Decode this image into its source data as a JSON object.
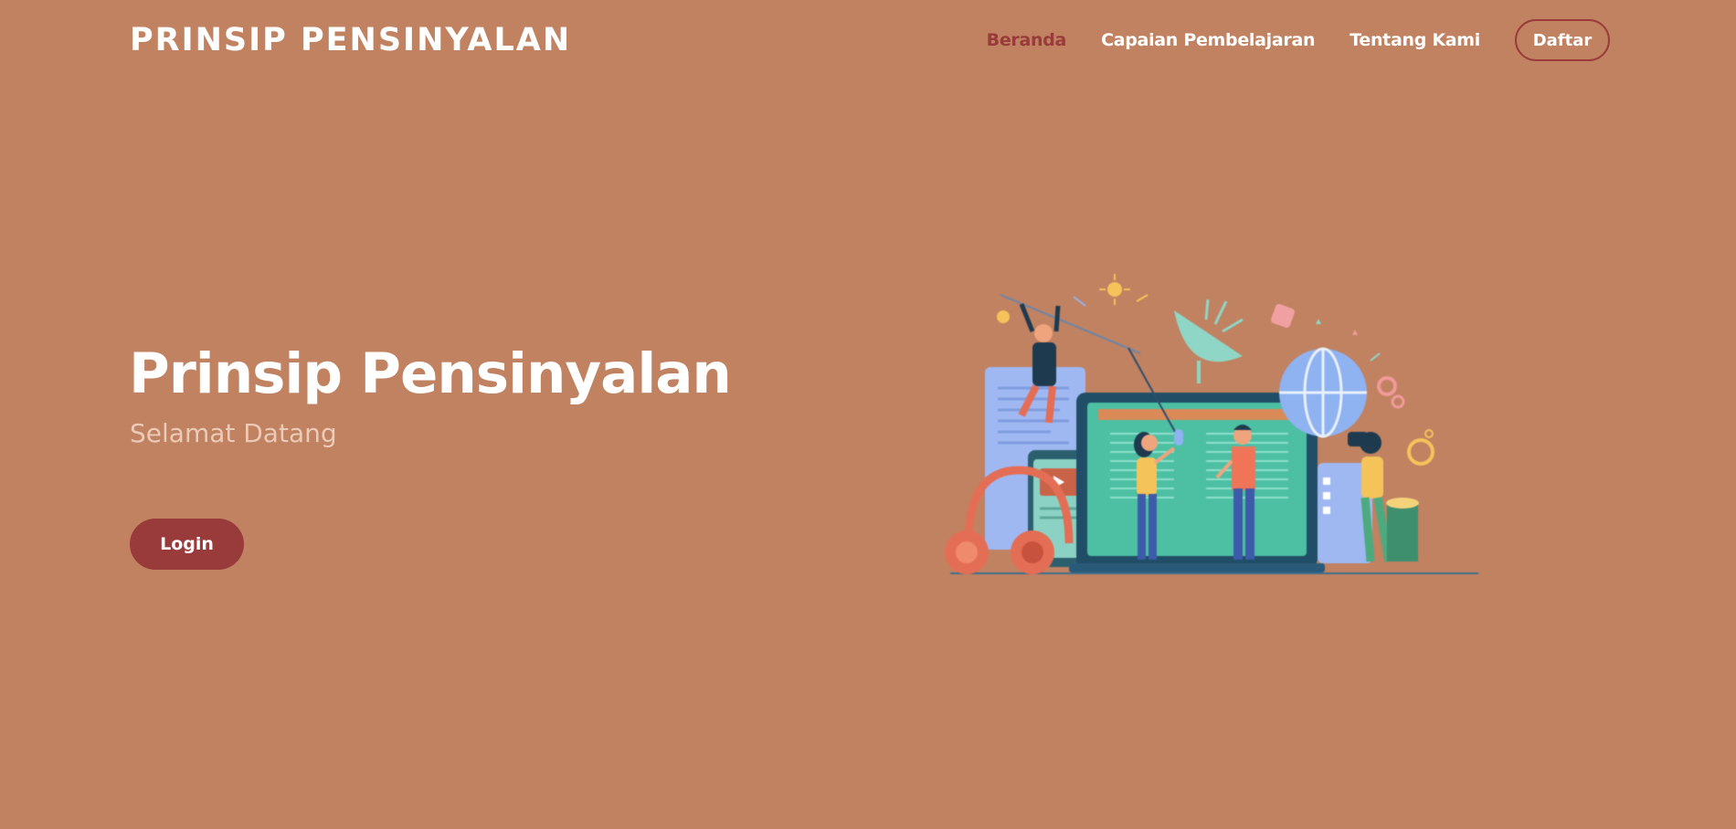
{
  "header": {
    "logo": "PRINSIP PENSINYALAN",
    "nav": [
      "Beranda",
      "Capaian Pembelajaran",
      "Tentang Kami"
    ],
    "register_label": "Daftar"
  },
  "hero": {
    "title": "Prinsip Pensinyalan",
    "subtitle": "Selamat Datang",
    "login_label": "Login"
  },
  "illustration": {
    "icon": "online-learning-illustration"
  },
  "colors": {
    "background": "#C08261",
    "accent": "#9A3B3B",
    "subtitle": "#EBCBB8",
    "text": "#FFFFFF"
  }
}
